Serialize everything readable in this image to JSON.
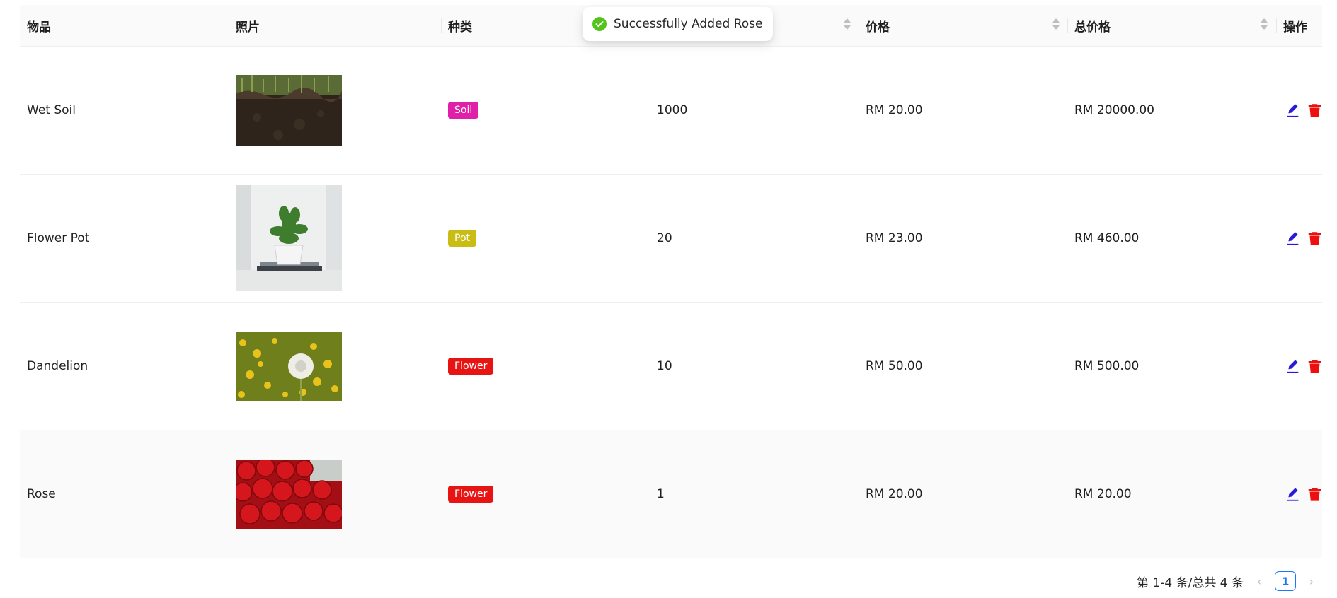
{
  "table": {
    "headers": [
      "物品",
      "照片",
      "种类",
      "",
      "价格",
      "总价格",
      "操作"
    ],
    "rows": [
      {
        "item": "Wet Soil",
        "photo": "soil-photo",
        "category": "Soil",
        "category_color": "#e020a8",
        "quantity": "1000",
        "price": "RM 20.00",
        "total": "RM 20000.00"
      },
      {
        "item": "Flower Pot",
        "photo": "potted-plant-photo",
        "category": "Pot",
        "category_color": "#c9bd14",
        "quantity": "20",
        "price": "RM 23.00",
        "total": "RM 460.00"
      },
      {
        "item": "Dandelion",
        "photo": "dandelion-photo",
        "category": "Flower",
        "category_color": "#e81414",
        "quantity": "10",
        "price": "RM 50.00",
        "total": "RM 500.00"
      },
      {
        "item": "Rose",
        "photo": "roses-photo",
        "category": "Flower",
        "category_color": "#e81414",
        "quantity": "1",
        "price": "RM 20.00",
        "total": "RM 20.00"
      }
    ],
    "icons": {
      "edit": "edit-icon",
      "delete": "trash-icon"
    },
    "colors": {
      "edit": "#2b18d8",
      "delete": "#ee1010"
    }
  },
  "toast": {
    "message": "Successfully Added Rose",
    "icon": "check-circle-icon",
    "color": "#52c41a"
  },
  "pagination": {
    "summary": "第 1-4 条/总共 4 条",
    "current_page": "1"
  }
}
